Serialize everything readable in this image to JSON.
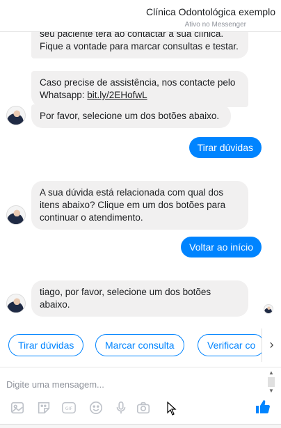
{
  "header": {
    "title": "Clínica Odontológica exemplo",
    "status": "Ativo no Messenger"
  },
  "messages": [
    {
      "from": "bot",
      "text": "seu paciente terá ao contactar a sua clínica. Fique a vontade para marcar consultas e testar."
    },
    {
      "from": "bot",
      "text_before": "Caso precise de assistência, nos contacte pelo Whatsapp: ",
      "link": "bit.ly/2EHofwL"
    },
    {
      "from": "bot",
      "text": "Por favor, selecione um dos botões abaixo."
    },
    {
      "from": "user",
      "text": "Tirar dúvidas"
    },
    {
      "from": "bot",
      "text": "A sua dúvida está relacionada com qual dos itens abaixo? Clique em um dos botões para continuar o atendimento."
    },
    {
      "from": "user",
      "text": "Voltar ao início"
    },
    {
      "from": "bot",
      "text": "tiago, por favor, selecione um dos botões abaixo."
    }
  ],
  "quick_replies": [
    "Tirar dúvidas",
    "Marcar consulta",
    "Verificar co"
  ],
  "composer": {
    "placeholder": "Digite uma mensagem...",
    "tools": [
      "image-icon",
      "sticker-icon",
      "gif-icon",
      "emoji-icon",
      "microphone-icon",
      "camera-icon"
    ],
    "like": "thumbs-up-icon"
  },
  "colors": {
    "accent": "#0084ff",
    "bubble": "#f1f0f0"
  }
}
